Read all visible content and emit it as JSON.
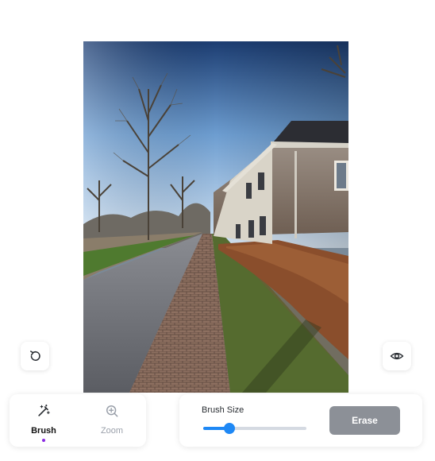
{
  "photo": {
    "description_icon": "landscape-photo"
  },
  "actions": {
    "undo_icon": "undo-icon",
    "preview_icon": "eye-icon"
  },
  "tools": [
    {
      "label": "Brush",
      "icon": "magic-wand-icon",
      "active": true
    },
    {
      "label": "Zoom",
      "icon": "zoom-in-icon",
      "active": false
    }
  ],
  "settings": {
    "brush_size_label": "Brush Size",
    "brush_size_fraction": 0.25,
    "erase_label": "Erase"
  },
  "colors": {
    "accent": "#1e88f5",
    "active_dot": "#8a2be2",
    "erase_button": "#8c9097"
  }
}
